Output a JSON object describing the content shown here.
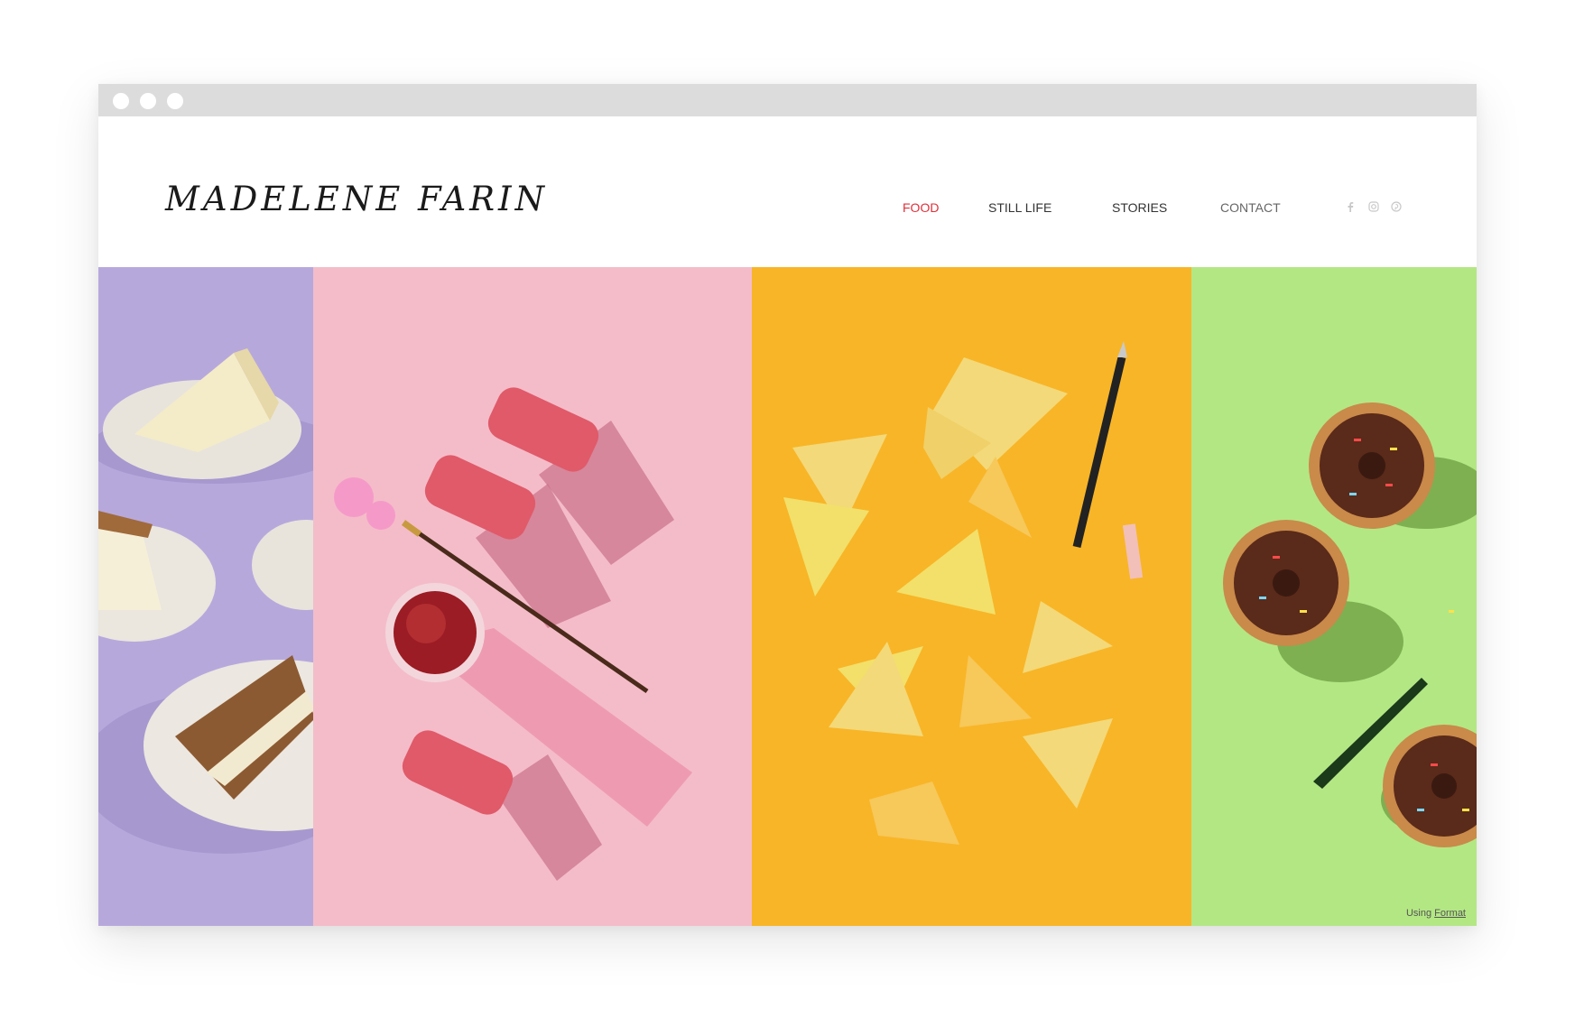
{
  "window": {
    "title_dots": 3
  },
  "site": {
    "logo": "MADELENE FARIN"
  },
  "nav": {
    "items": [
      {
        "label": "FOOD",
        "active": true
      },
      {
        "label": "STILL LIFE",
        "active": false
      },
      {
        "label": "STORIES",
        "active": false
      },
      {
        "label": "CONTACT",
        "active": false
      }
    ],
    "social_icons": [
      "facebook-icon",
      "instagram-icon",
      "pinterest-icon"
    ]
  },
  "gallery": {
    "panels": [
      {
        "subject": "cake-slices",
        "bg": "#b7a8dc"
      },
      {
        "subject": "pink-coconut-bars",
        "bg": "#f4bcc9"
      },
      {
        "subject": "tortilla-chips",
        "bg": "#f8b527"
      },
      {
        "subject": "sprinkle-donuts",
        "bg": "#b3e784"
      }
    ]
  },
  "footer": {
    "using_text": "Using",
    "format_link": "Format"
  },
  "colors": {
    "accent": "#e0303a",
    "chrome": "#dcdcdc"
  }
}
